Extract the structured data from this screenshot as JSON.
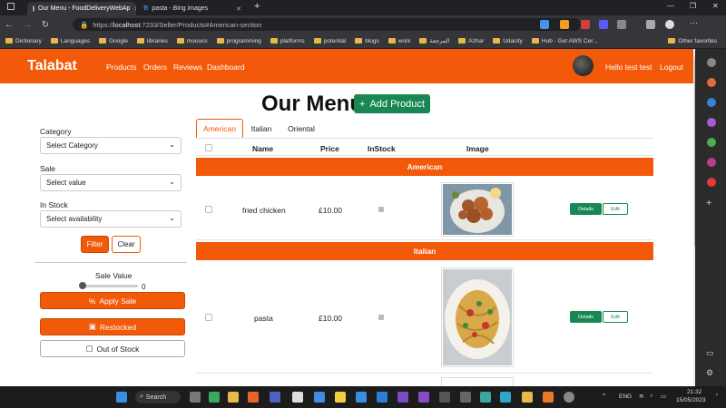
{
  "browser": {
    "tabs": [
      {
        "title": "Our Menu - FoodDeliveryWebAp"
      },
      {
        "title": "pasta - Bing images"
      }
    ],
    "url_prefix": "https://",
    "url_host": "localhost",
    "url_rest": ":7233/Seller/Products#American-section",
    "bookmarks": [
      "Dictionary",
      "Languages",
      "Google",
      "libraries",
      "mooocs",
      "programming",
      "platforms",
      "potential",
      "blogs",
      "work",
      "المرجعة",
      "Azhar",
      "Udacity",
      "Hub - Get AWS Cer...",
      "Other favorites"
    ]
  },
  "navbar": {
    "brand": "Talabat",
    "links": [
      "Products",
      "Orders",
      "Reviews",
      "Dashboard"
    ],
    "greeting": "Hello test test",
    "logout": "Logout"
  },
  "page": {
    "title": "Our Menu",
    "add_product": "Add Product"
  },
  "filters": {
    "category_label": "Category",
    "category_value": "Select Category",
    "sale_label": "Sale",
    "sale_value": "Select value",
    "stock_label": "In Stock",
    "stock_value": "Select availability",
    "filter_btn": "Filter",
    "clear_btn": "Clear",
    "sale_value_label": "Sale Value",
    "slider_value": "0",
    "apply_sale": "Apply Sale",
    "restocked": "Restocked",
    "out_of_stock": "Out of Stock"
  },
  "tabs": [
    "American",
    "Italian",
    "Oriental"
  ],
  "table": {
    "headers": [
      "Name",
      "Price",
      "InStock",
      "Image"
    ],
    "sections": [
      {
        "title": "American",
        "rows": [
          {
            "name": "fried chicken",
            "price": "£10.00"
          }
        ]
      },
      {
        "title": "Italian",
        "rows": [
          {
            "name": "pasta",
            "price": "£10.00"
          }
        ]
      }
    ],
    "details_label": "Details",
    "edit_label": "Edit"
  },
  "taskbar": {
    "search": "Search",
    "lang": "ENG",
    "time": "21:32",
    "date": "15/05/2023"
  },
  "colors": {
    "brand": "#f25a0a",
    "success": "#198754"
  }
}
